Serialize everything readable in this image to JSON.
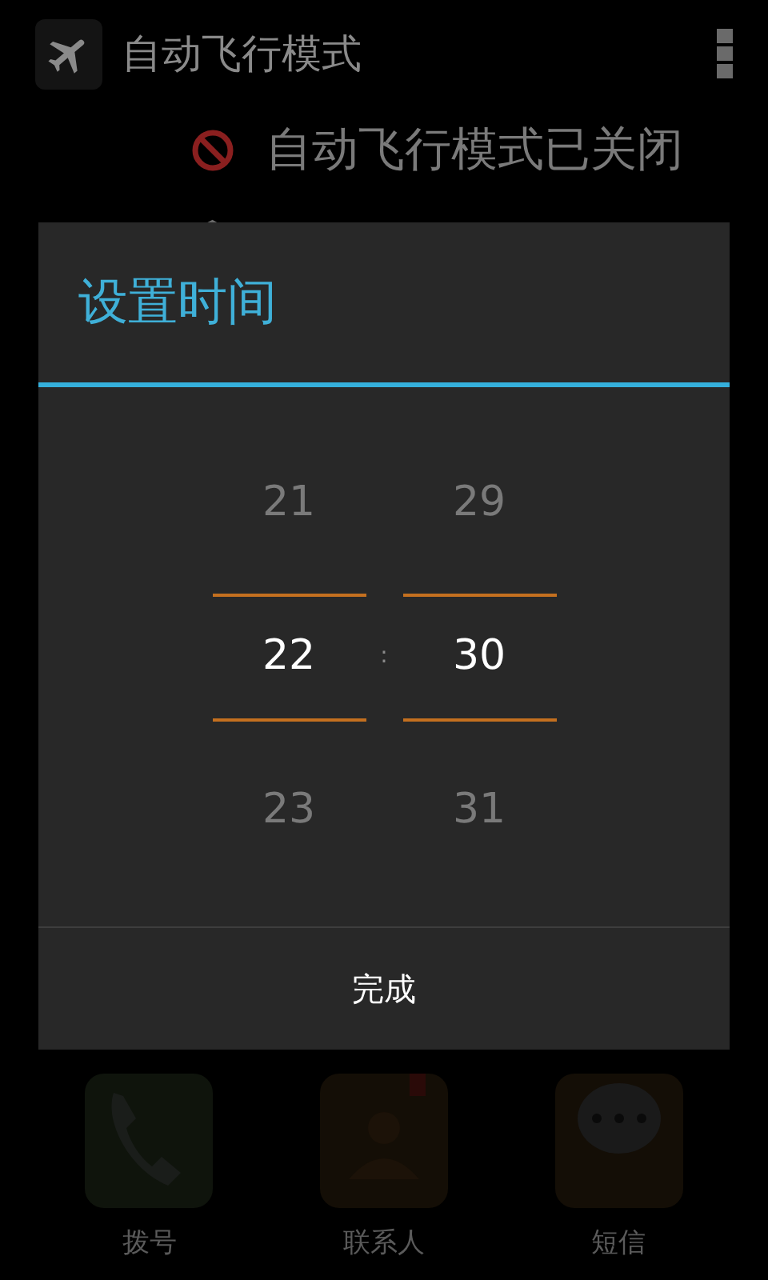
{
  "action_bar": {
    "title": "自动飞行模式"
  },
  "status": {
    "text": "自动飞行模式已关闭",
    "enabled": false
  },
  "dialog": {
    "title": "设置时间",
    "separator": ":",
    "button": "完成",
    "pickers": [
      {
        "values": [
          {
            "text": "21",
            "selected": false
          },
          {
            "text": "22",
            "selected": true
          },
          {
            "text": "23",
            "selected": false
          }
        ]
      },
      {
        "values": [
          {
            "text": "29",
            "selected": false
          },
          {
            "text": "30",
            "selected": true
          },
          {
            "text": "31",
            "selected": false
          }
        ]
      }
    ]
  },
  "dock": [
    {
      "label": "拨号",
      "kind": "phone"
    },
    {
      "label": "联系人",
      "kind": "contacts"
    },
    {
      "label": "短信",
      "kind": "message"
    }
  ]
}
